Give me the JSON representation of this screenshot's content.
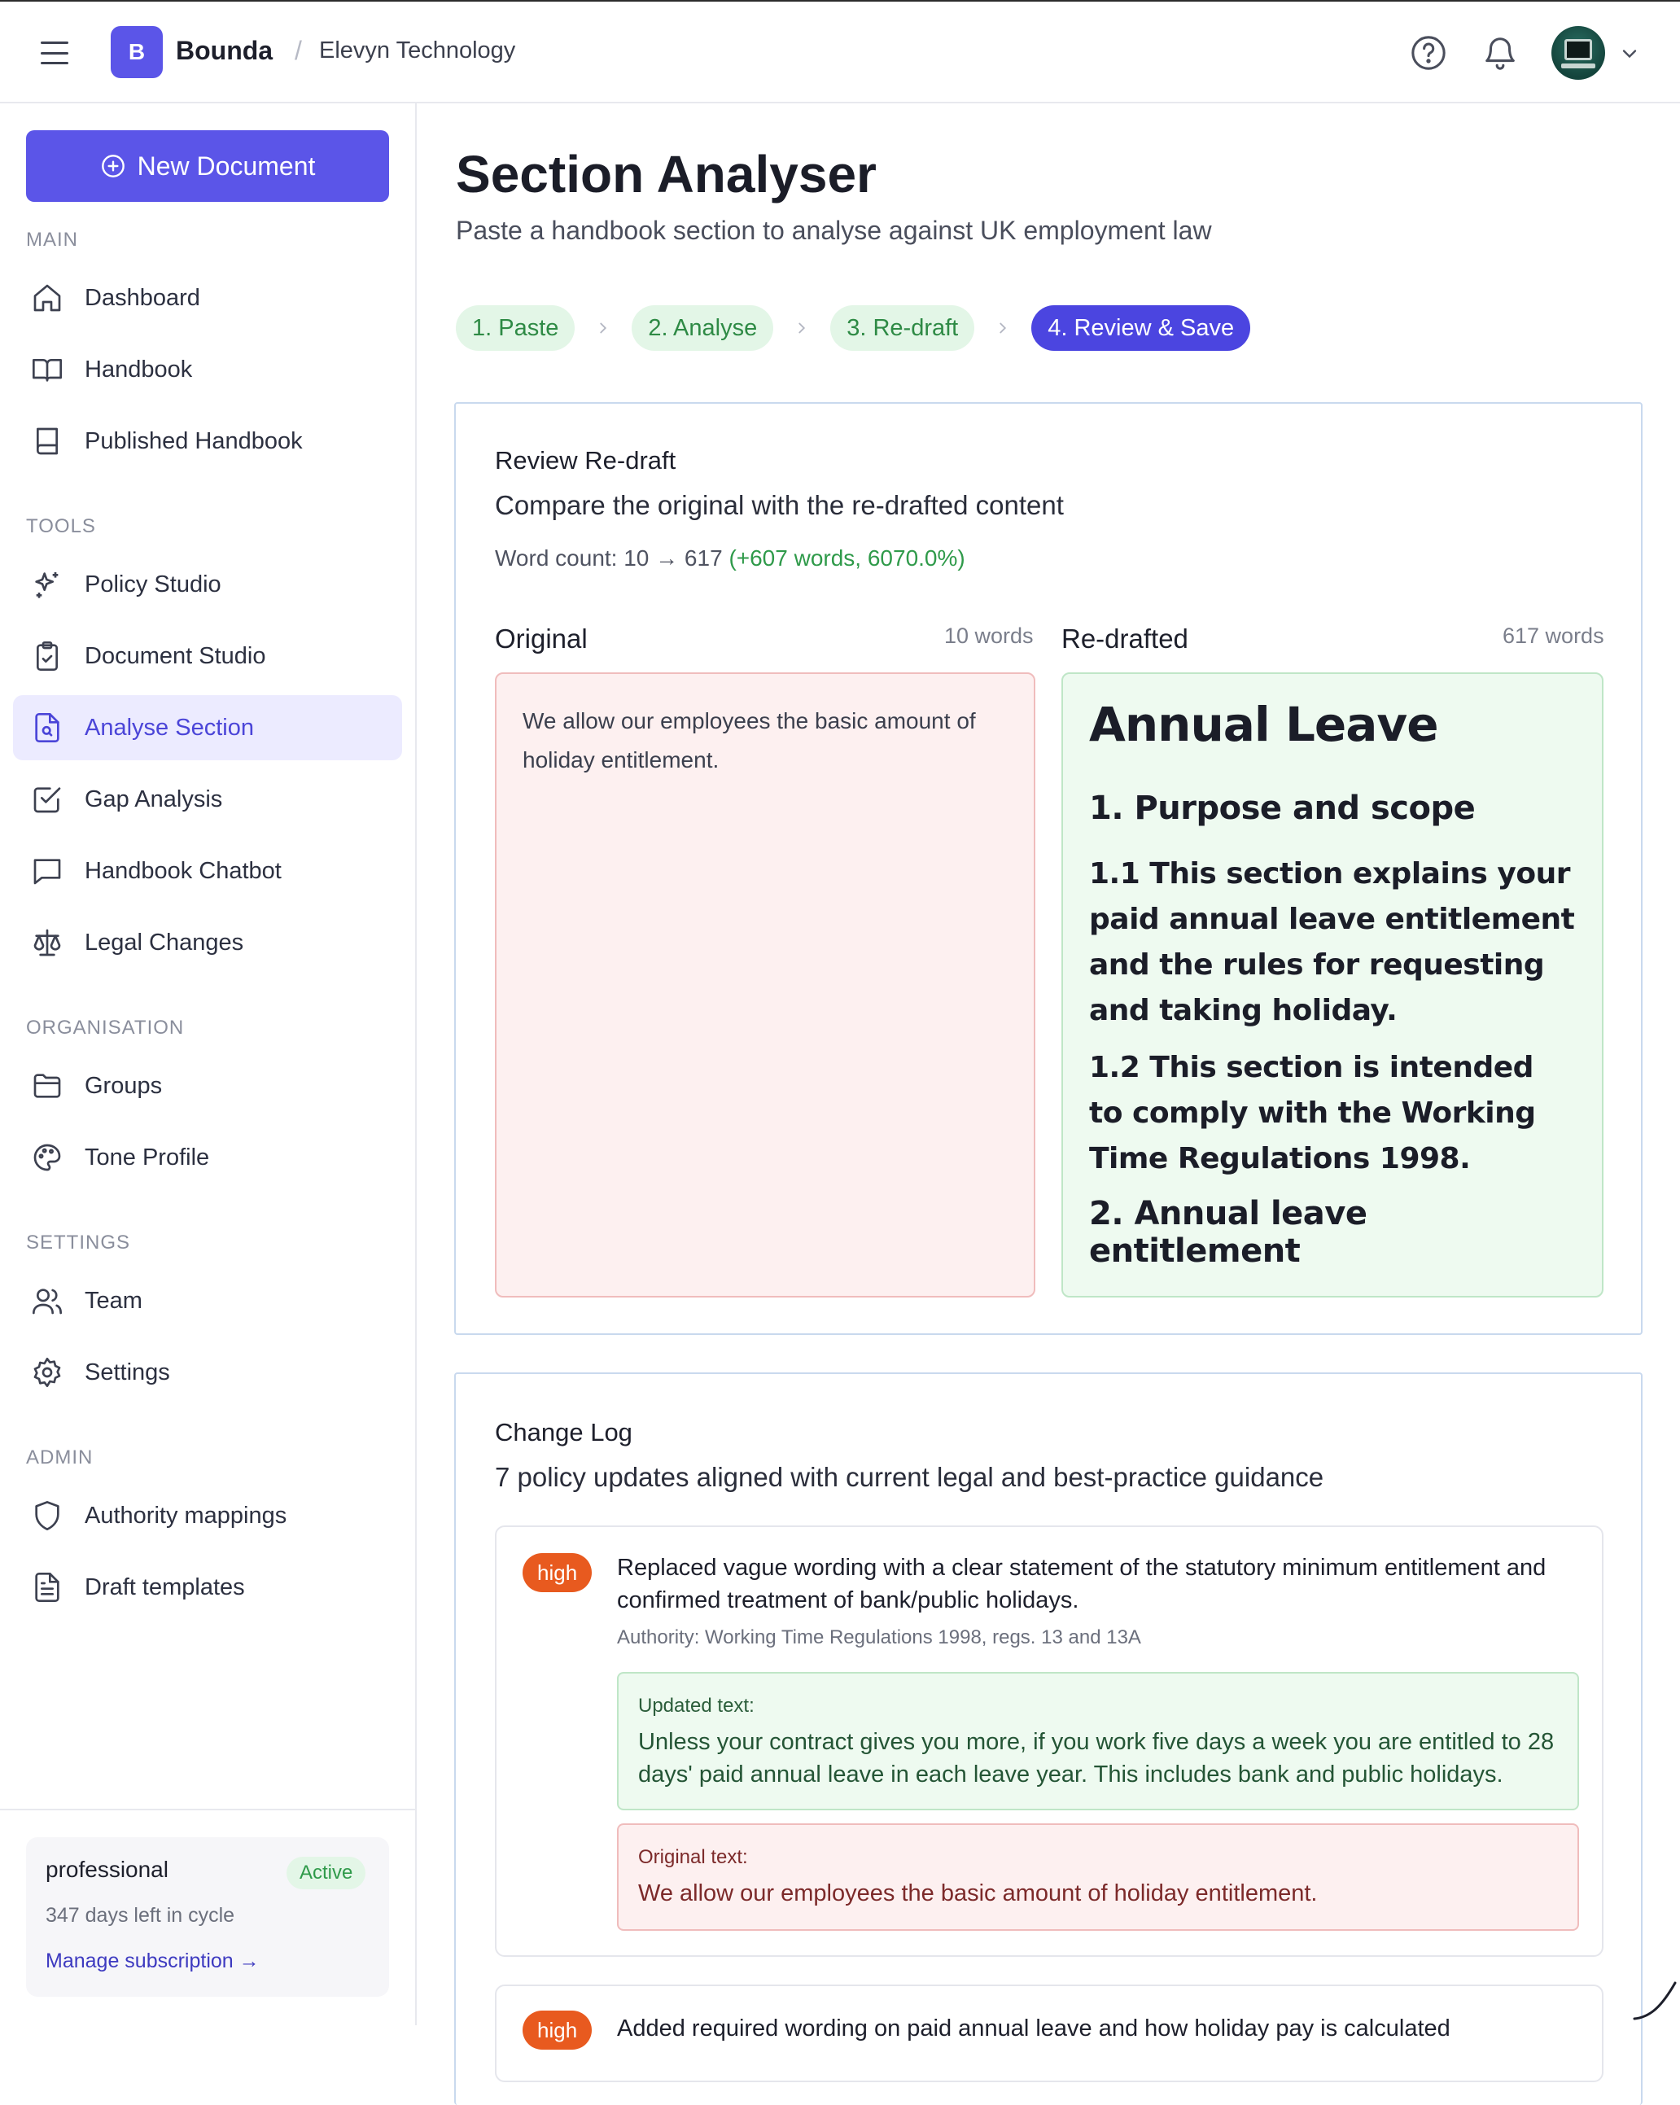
{
  "topbar": {
    "brand_initial": "B",
    "brand_name": "Bounda",
    "breadcrumb_sep": "/",
    "org_name": "Elevyn Technology"
  },
  "sidebar": {
    "new_document": "New Document",
    "sections": [
      {
        "heading": "MAIN",
        "items": [
          {
            "label": "Dashboard",
            "icon": "home-icon"
          },
          {
            "label": "Handbook",
            "icon": "book-open-icon"
          },
          {
            "label": "Published Handbook",
            "icon": "book-icon"
          }
        ]
      },
      {
        "heading": "TOOLS",
        "items": [
          {
            "label": "Policy Studio",
            "icon": "sparkles-icon"
          },
          {
            "label": "Document Studio",
            "icon": "clipboard-check-icon"
          },
          {
            "label": "Analyse Section",
            "icon": "file-search-icon",
            "active": true
          },
          {
            "label": "Gap Analysis",
            "icon": "checkbox-icon"
          },
          {
            "label": "Handbook Chatbot",
            "icon": "chat-icon"
          },
          {
            "label": "Legal Changes",
            "icon": "scale-icon"
          }
        ]
      },
      {
        "heading": "ORGANISATION",
        "items": [
          {
            "label": "Groups",
            "icon": "folder-icon"
          },
          {
            "label": "Tone Profile",
            "icon": "palette-icon"
          }
        ]
      },
      {
        "heading": "SETTINGS",
        "items": [
          {
            "label": "Team",
            "icon": "users-icon"
          },
          {
            "label": "Settings",
            "icon": "gear-icon"
          }
        ]
      },
      {
        "heading": "ADMIN",
        "items": [
          {
            "label": "Authority mappings",
            "icon": "shield-icon"
          },
          {
            "label": "Draft templates",
            "icon": "file-text-icon"
          }
        ]
      }
    ],
    "plan": {
      "name": "professional",
      "status": "Active",
      "days_left": "347 days left in cycle",
      "manage_link": "Manage subscription →"
    }
  },
  "main": {
    "title": "Section Analyser",
    "subtitle": "Paste a handbook section to analyse against UK employment law",
    "steps": [
      "1. Paste",
      "2. Analyse",
      "3. Re-draft",
      "4. Review & Save"
    ],
    "current_step": 4,
    "review": {
      "title": "Review Re-draft",
      "description": "Compare the original with the re-drafted content",
      "word_count_prefix": "Word count: 10 → 617",
      "word_count_delta": "(+607 words, 6070.0%)",
      "original_label": "Original",
      "original_count": "10 words",
      "original_text": "We allow our employees the basic amount of holiday entitlement.",
      "redrafted_label": "Re-drafted",
      "redrafted_count": "617 words",
      "redrafted": {
        "h1": "Annual Leave",
        "h2_1": "1. Purpose and scope",
        "p1": "1.1 This section explains your paid annual leave entitlement and the rules for requesting and taking holiday.",
        "p2_prefix": "1.2 This section is intended to comply with the ",
        "p2_bold": "Working Time Regulations 1998",
        "p2_suffix": ".",
        "h2_2": "2. Annual leave entitlement"
      }
    },
    "changelog": {
      "title": "Change Log",
      "description": "7 policy updates aligned with current legal and best-practice guidance",
      "items": [
        {
          "severity": "high",
          "title": "Replaced vague wording with a clear statement of the statutory minimum entitlement and confirmed treatment of bank/public holidays.",
          "authority": "Authority: Working Time Regulations 1998, regs. 13 and 13A",
          "updated_label": "Updated text:",
          "updated_text": "Unless your contract gives you more, if you work five days a week you are entitled to 28 days' paid annual leave in each leave year. This includes bank and public holidays.",
          "original_label": "Original text:",
          "original_text": "We allow our employees the basic amount of holiday entitlement."
        },
        {
          "severity": "high",
          "title": "Added required wording on paid annual leave and how holiday pay is calculated"
        }
      ]
    }
  }
}
